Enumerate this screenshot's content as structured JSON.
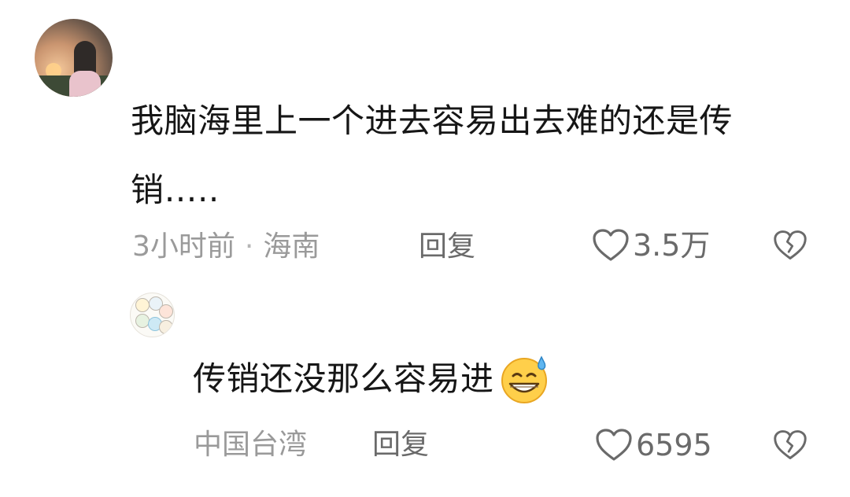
{
  "comments": [
    {
      "text": "我脑海里上一个进去容易出去难的还是传销…..",
      "time": "3小时前",
      "separator": "·",
      "location": "海南",
      "reply_label": "回复",
      "likes": "3.5万"
    }
  ],
  "reply": {
    "text": "传销还没那么容易进",
    "emoji": "grinning-face-with-sweat",
    "location": "中国台湾",
    "reply_label": "回复",
    "likes": "6595"
  },
  "icons": {
    "like": "heart-outline-icon",
    "dislike": "broken-heart-outline-icon"
  }
}
